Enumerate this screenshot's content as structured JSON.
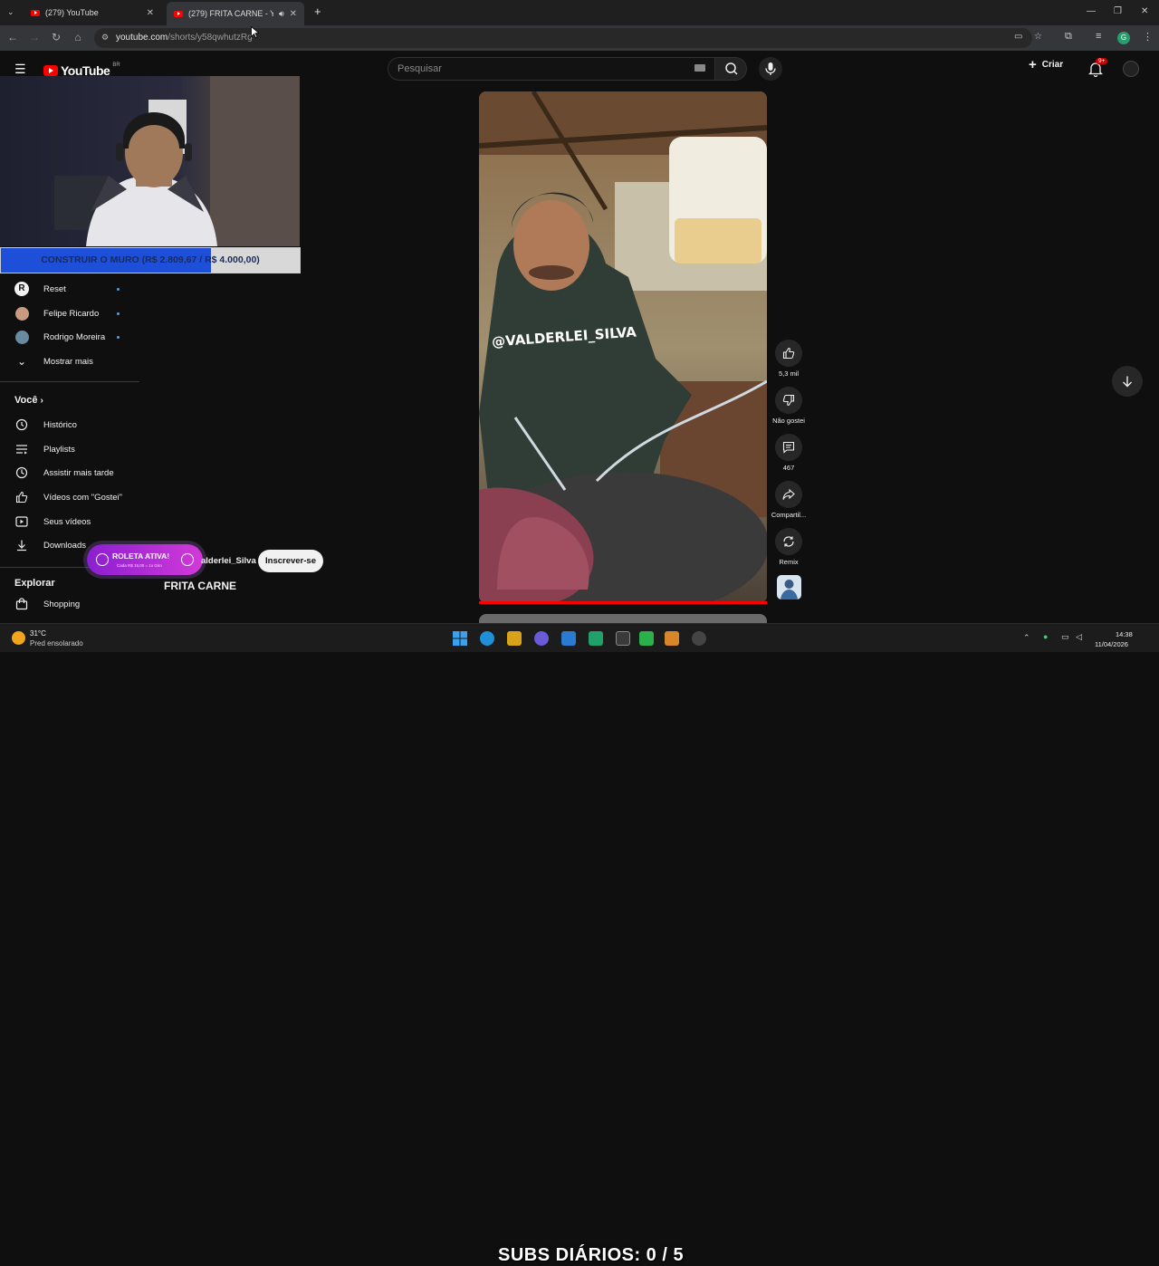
{
  "browser": {
    "tabs": [
      {
        "title": "(279) YouTube"
      },
      {
        "title": "(279) FRITA CARNE - YouTube"
      }
    ],
    "url_domain": "youtube.com",
    "url_path": "/shorts/y58qwhutzRg",
    "profile_letter": "G"
  },
  "youtube": {
    "logo_text": "YouTube",
    "logo_region": "BR",
    "search_placeholder": "Pesquisar",
    "create_label": "Criar",
    "notifications_badge": "9+"
  },
  "goal": {
    "text": "CONSTRUIR O MURO (R$ 2.809,67 / R$ 4.000,00)",
    "progress": 0.7024,
    "fill_color": "#1e4fd8"
  },
  "sidebar": {
    "subscriptions": [
      {
        "label": "Reset",
        "icon": "channel-avatar-icon"
      },
      {
        "label": "Felipe Ricardo",
        "icon": "channel-avatar-icon"
      },
      {
        "label": "Rodrigo Moreira",
        "icon": "channel-avatar-icon"
      }
    ],
    "show_more": "Mostrar mais",
    "you_heading": "Você",
    "you_items": [
      {
        "label": "Histórico",
        "icon": "history-icon"
      },
      {
        "label": "Playlists",
        "icon": "playlist-icon"
      },
      {
        "label": "Assistir mais tarde",
        "icon": "clock-icon"
      },
      {
        "label": "Vídeos com \"Gostei\"",
        "icon": "thumbs-up-icon"
      },
      {
        "label": "Seus vídeos",
        "icon": "play-icon"
      },
      {
        "label": "Downloads",
        "icon": "download-icon"
      }
    ],
    "explore_heading": "Explorar",
    "explore_items": [
      {
        "label": "Shopping",
        "icon": "shopping-bag-icon"
      }
    ]
  },
  "short": {
    "overlay_text": "@VALDERLEI_SILVA",
    "channel": "@Valderlei_Silva",
    "channel_visible": "alderlei_Silva",
    "subscribe_label": "Inscrever-se",
    "title": "FRITA CARNE",
    "progress": 1.0,
    "actions": {
      "like_count": "5,3 mil",
      "dislike_label": "Não gostei",
      "comments_count": "467",
      "share_label": "Compartil...",
      "remix_label": "Remix"
    }
  },
  "roleta": {
    "title": "ROLETA ATIVA!",
    "subtitle": "Cada R$ 15,00 = 1x Giro"
  },
  "stream_overlay": {
    "subs_text": "SUBS DIÁRIOS: 0 / 5"
  },
  "taskbar": {
    "weather_temp": "31°C",
    "weather_desc": "Pred ensolarado",
    "time": "14:38",
    "date": "11/04/2026"
  }
}
